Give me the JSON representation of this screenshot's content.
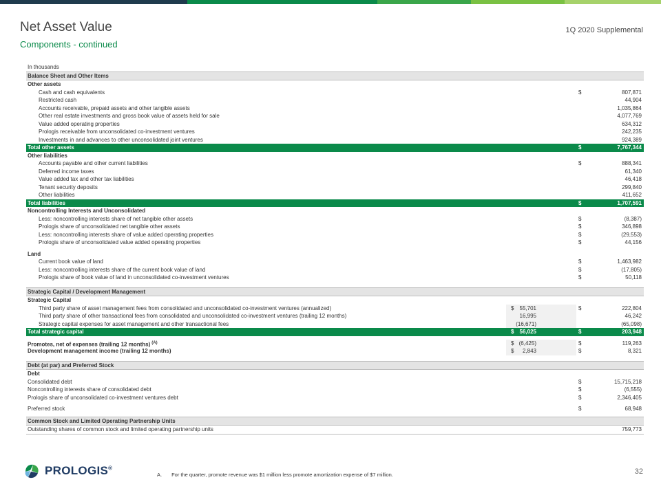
{
  "header": {
    "title": "Net Asset Value",
    "subtitle": "Components - continued",
    "supplemental": "1Q 2020 Supplemental"
  },
  "colors": {
    "bar": [
      "#1f3b4d",
      "#0a8a4a",
      "#3aa64a",
      "#7ac143",
      "#a6d26b"
    ],
    "accent_green": "#0a8a4a",
    "section_gray": "#e4e4e4"
  },
  "table": {
    "units": "In thousands",
    "balance_sheet": {
      "heading": "Balance Sheet and Other Items",
      "other_assets_label": "Other assets",
      "other_assets": [
        {
          "label": "Cash and cash equivalents",
          "cur": "$",
          "value": "807,871"
        },
        {
          "label": "Restricted cash",
          "cur": "",
          "value": "44,904"
        },
        {
          "label": "Accounts receivable, prepaid assets and other tangible assets",
          "cur": "",
          "value": "1,035,864"
        },
        {
          "label": "Other real estate investments and gross book value of assets held for sale",
          "cur": "",
          "value": "4,077,769"
        },
        {
          "label": "Value added operating properties",
          "cur": "",
          "value": "634,312"
        },
        {
          "label": "Prologis receivable from unconsolidated co-investment ventures",
          "cur": "",
          "value": "242,235"
        },
        {
          "label": "Investments in and advances to other unconsolidated joint ventures",
          "cur": "",
          "value": "924,389"
        }
      ],
      "total_other_assets": {
        "label": "Total other assets",
        "cur": "$",
        "value": "7,767,344"
      },
      "other_liabilities_label": "Other liabilities",
      "other_liabilities": [
        {
          "label": "Accounts payable and other current liabilities",
          "cur": "$",
          "value": "888,341"
        },
        {
          "label": "Deferred income taxes",
          "cur": "",
          "value": "61,340"
        },
        {
          "label": "Value added tax and other tax liabilities",
          "cur": "",
          "value": "46,418"
        },
        {
          "label": "Tenant security deposits",
          "cur": "",
          "value": "299,840"
        },
        {
          "label": "Other liabilities",
          "cur": "",
          "value": "411,652"
        }
      ],
      "total_liabilities": {
        "label": "Total liabilities",
        "cur": "$",
        "value": "1,707,591"
      },
      "nci_label": "Noncontrolling Interests and Unconsolidated",
      "nci": [
        {
          "label": "Less: noncontrolling interests share of net tangible other assets",
          "cur": "$",
          "value": "(8,387)"
        },
        {
          "label": "Prologis share of unconsolidated net tangible other assets",
          "cur": "$",
          "value": "346,898"
        },
        {
          "label": "Less: noncontrolling interests share of value added operating properties",
          "cur": "$",
          "value": "(29,553)"
        },
        {
          "label": "Prologis share of unconsolidated value added operating properties",
          "cur": "$",
          "value": "44,156"
        }
      ],
      "land_label": "Land",
      "land": [
        {
          "label": "Current book value of land",
          "cur": "$",
          "value": "1,463,982"
        },
        {
          "label": "Less: noncontrolling interests share of the current book value of land",
          "cur": "$",
          "value": "(17,805)"
        },
        {
          "label": "Prologis share of book value of land in unconsolidated co-investment ventures",
          "cur": "$",
          "value": "50,118"
        }
      ]
    },
    "strategic": {
      "heading": "Strategic Capital / Development Management",
      "sub_label": "Strategic Capital",
      "rows": [
        {
          "label": "Third party share of asset management fees from consolidated and unconsolidated co-investment ventures (annualized)",
          "cur1": "$",
          "v1": "55,701",
          "cur2": "$",
          "v2": "222,804"
        },
        {
          "label": "Third party share of other transactional fees from consolidated and unconsolidated co-investment ventures (trailing 12 months)",
          "cur1": "",
          "v1": "16,995",
          "cur2": "",
          "v2": "46,242"
        },
        {
          "label": "Strategic capital expenses for asset management and other transactional fees",
          "cur1": "",
          "v1": "(16,671)",
          "cur2": "",
          "v2": "(65,098)"
        }
      ],
      "total": {
        "label": "Total strategic capital",
        "cur1": "$",
        "v1": "56,025",
        "cur2": "$",
        "v2": "203,948"
      },
      "promotes": {
        "label": "Promotes, net of expenses (trailing 12 months)",
        "note": "(A)",
        "cur1": "$",
        "v1": "(6,425)",
        "cur2": "$",
        "v2": "119,263"
      },
      "dev_mgmt": {
        "label": "Development management income (trailing 12 months)",
        "cur1": "$",
        "v1": "2,843",
        "cur2": "$",
        "v2": "8,321"
      }
    },
    "debt": {
      "heading": "Debt (at par) and Preferred Stock",
      "sub_label": "Debt",
      "rows": [
        {
          "label": "Consolidated debt",
          "cur": "$",
          "value": "15,715,218"
        },
        {
          "label": "Noncontrolling interests share of consolidated debt",
          "cur": "$",
          "value": "(6,555)"
        },
        {
          "label": "Prologis share of unconsolidated co-investment ventures debt",
          "cur": "$",
          "value": "2,346,405"
        }
      ],
      "preferred": {
        "label": "Preferred stock",
        "cur": "$",
        "value": "68,948"
      }
    },
    "shares": {
      "heading": "Common Stock and Limited Operating Partnership Units",
      "row": {
        "label": "Outstanding shares of common stock and limited operating partnership units",
        "value": "759,773"
      }
    }
  },
  "footer": {
    "logo_text": "PROLOGIS",
    "logo_mark": "®",
    "footnote_letter": "A.",
    "footnote": "For the quarter, promote revenue was $1 million less promote amortization expense of $7 million.",
    "page_number": "32"
  }
}
